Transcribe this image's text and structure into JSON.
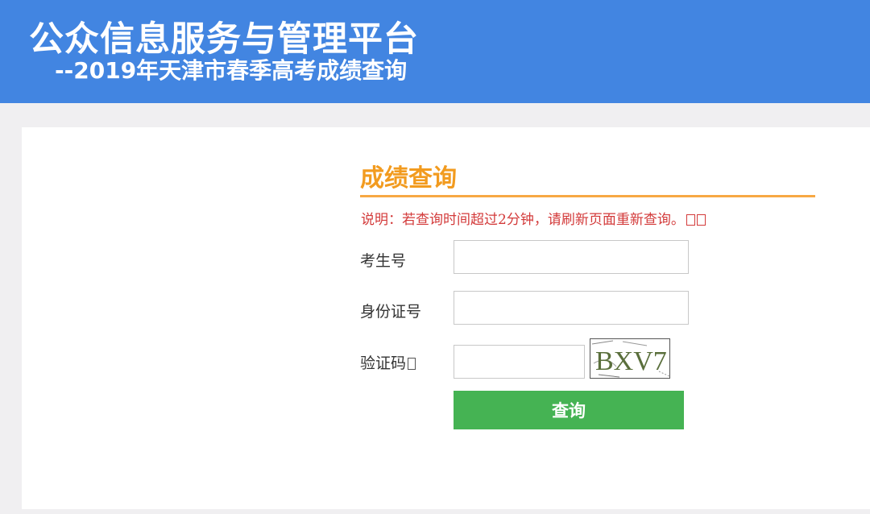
{
  "header": {
    "title": "公众信息服务与管理平台",
    "subtitle": "--2019年天津市春季高考成绩查询"
  },
  "section": {
    "title": "成绩查询",
    "notice": "说明：若查询时间超过2分钟，请刷新页面重新查询。"
  },
  "form": {
    "exam_number_label": "考生号",
    "exam_number_value": "",
    "id_number_label": "身份证号",
    "id_number_value": "",
    "captcha_label": "验证码",
    "captcha_value": "",
    "captcha_text": "BXV7",
    "submit_label": "查询"
  },
  "colors": {
    "header_bg": "#4285e1",
    "title_accent": "#f29b1f",
    "notice_text": "#d33a3a",
    "submit_bg": "#45b353"
  }
}
